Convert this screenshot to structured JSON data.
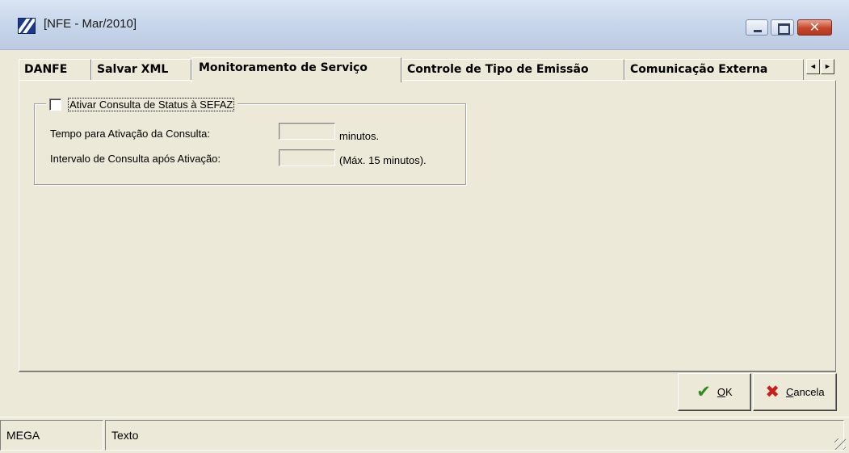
{
  "window": {
    "title": "[NFE - Mar/2010]",
    "icon": "app-logo-icon"
  },
  "tabs": [
    {
      "label": "DANFE",
      "active": false
    },
    {
      "label": "Salvar XML",
      "active": false
    },
    {
      "label": "Monitoramento de Serviço",
      "active": true
    },
    {
      "label": "Controle de Tipo de Emissão",
      "active": false
    },
    {
      "label": "Comunicação Externa",
      "active": false
    }
  ],
  "tab_scroll": {
    "left_icon": "arrow-left-icon",
    "right_icon": "arrow-right-icon",
    "left": "◄",
    "right": "►"
  },
  "group": {
    "checkbox_label": "Ativar Consulta de Status à SEFAZ",
    "checked": false,
    "rows": [
      {
        "label": "Tempo para Ativação da Consulta:",
        "value": "",
        "unit": "minutos."
      },
      {
        "label": "Intervalo de Consulta após Ativação:",
        "value": "",
        "unit": "(Máx. 15 minutos)."
      }
    ]
  },
  "buttons": {
    "ok": {
      "underline": "O",
      "rest": "K"
    },
    "cancel": {
      "underline": "C",
      "rest": "ancela"
    }
  },
  "statusbar": {
    "cell1": "MEGA",
    "cell2": "Texto"
  },
  "colors": {
    "face": "#ece9d8",
    "ok_icon": "#2e8b1f",
    "cancel_icon": "#c8201c",
    "close_button": "#c8452a"
  }
}
